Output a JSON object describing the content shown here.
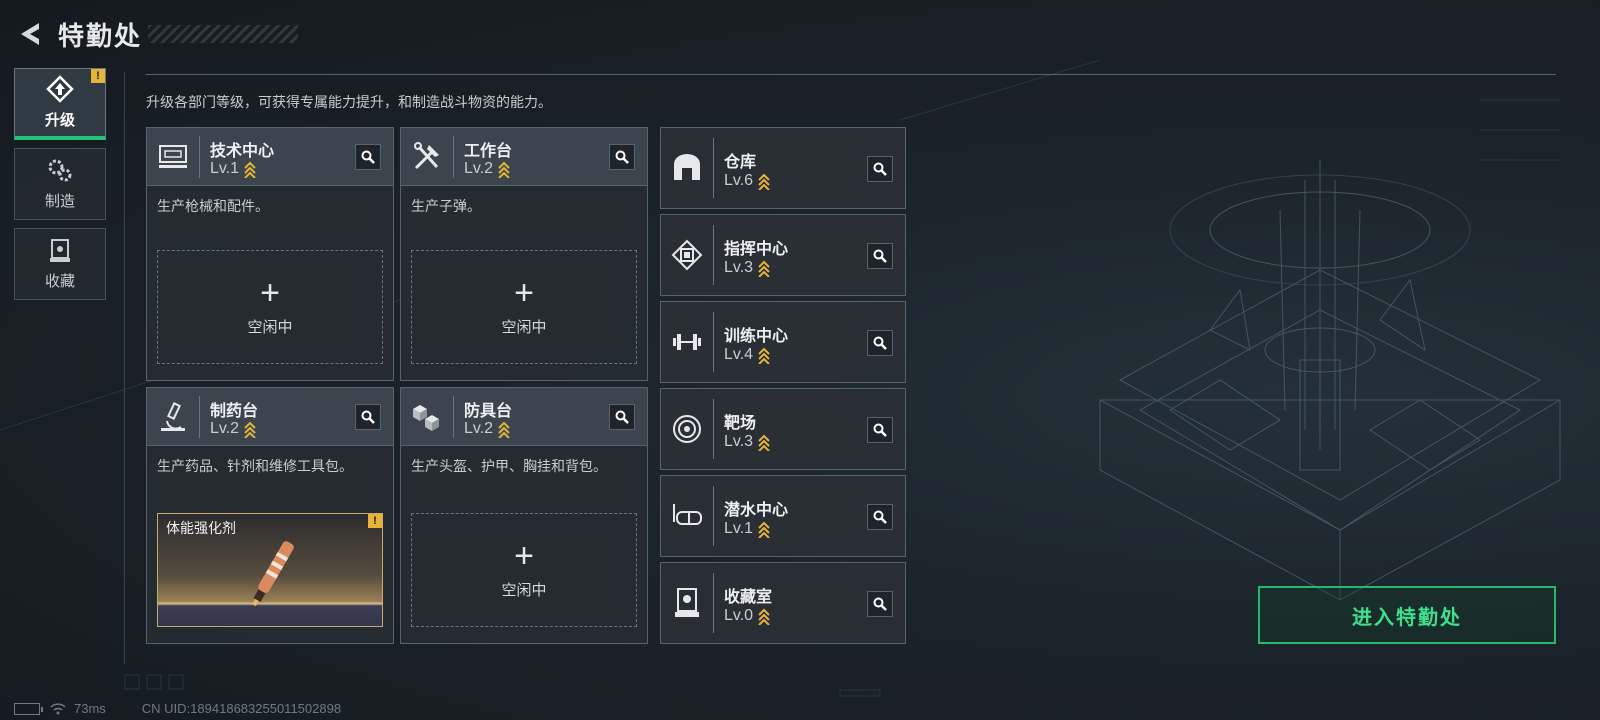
{
  "header": {
    "title": "特勤处"
  },
  "sidenav": {
    "items": [
      {
        "label": "升级",
        "icon": "upgrade-icon",
        "active": true,
        "alert": "!"
      },
      {
        "label": "制造",
        "icon": "gears-icon",
        "active": false
      },
      {
        "label": "收藏",
        "icon": "collection-icon",
        "active": false
      }
    ]
  },
  "description": "升级各部门等级，可获得专属能力提升，和制造战斗物资的能力。",
  "stations": [
    {
      "name": "技术中心",
      "level": "Lv.1",
      "desc": "生产枪械和配件。",
      "slot_text": "空闲中",
      "icon": "computer-icon"
    },
    {
      "name": "工作台",
      "level": "Lv.2",
      "desc": "生产子弹。",
      "slot_text": "空闲中",
      "icon": "tools-icon"
    },
    {
      "name": "制药台",
      "level": "Lv.2",
      "desc": "生产药品、针剂和维修工具包。",
      "slot_item": "体能强化剂",
      "slot_alert": "!",
      "icon": "microscope-icon"
    },
    {
      "name": "防具台",
      "level": "Lv.2",
      "desc": "生产头盔、护甲、胸挂和背包。",
      "slot_text": "空闲中",
      "icon": "armor-boxes-icon"
    }
  ],
  "facilities": [
    {
      "name": "仓库",
      "level": "Lv.6",
      "icon": "warehouse-icon"
    },
    {
      "name": "指挥中心",
      "level": "Lv.3",
      "icon": "chip-icon"
    },
    {
      "name": "训练中心",
      "level": "Lv.4",
      "icon": "dumbbell-icon"
    },
    {
      "name": "靶场",
      "level": "Lv.3",
      "icon": "target-icon"
    },
    {
      "name": "潜水中心",
      "level": "Lv.1",
      "icon": "diving-mask-icon"
    },
    {
      "name": "收藏室",
      "level": "Lv.0",
      "icon": "display-case-icon"
    }
  ],
  "enter_button": "进入特勤处",
  "status": {
    "ping": "73ms",
    "uid": "CN UID:18941868325501150​2898"
  },
  "colors": {
    "accent_green": "#25b872",
    "gold": "#e6b43a",
    "panel": "#3c454d"
  }
}
